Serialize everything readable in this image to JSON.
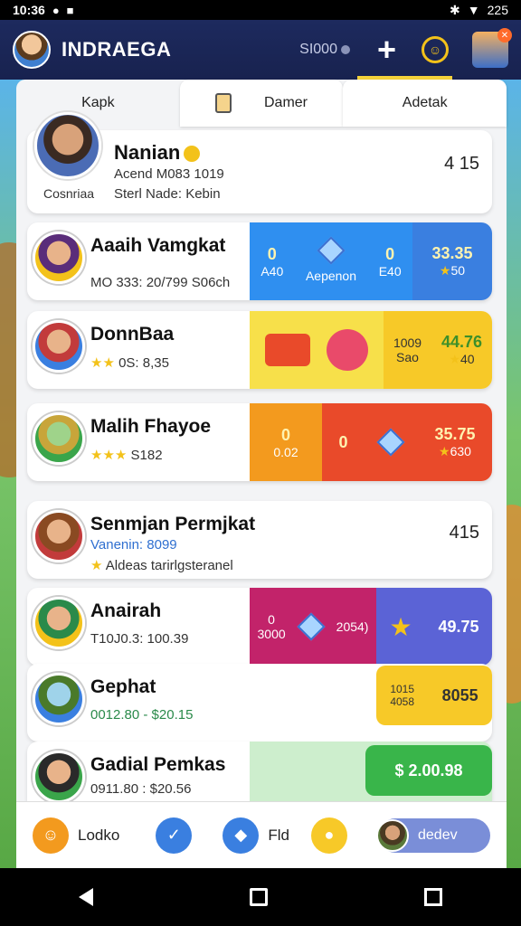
{
  "status": {
    "time": "10:36",
    "battery": "225"
  },
  "header": {
    "title": "INDRAEGA",
    "coins": "SI000"
  },
  "tabs": [
    {
      "label": "Kapk"
    },
    {
      "label": "Damer"
    },
    {
      "label": "Adetak"
    }
  ],
  "profile": {
    "name": "Nanian",
    "line2": "Acend M083 1019",
    "line3": "Sterl Nade: Kebin",
    "caption": "Cosnriaa",
    "value": "4 15"
  },
  "rows": [
    {
      "name": "Aaaih Vamgkat",
      "sub": "MO 333: 20/799 S06ch",
      "segs": [
        "0",
        "A40",
        "Aepenon",
        "0",
        "E40",
        "33.35",
        "50"
      ],
      "value": ""
    },
    {
      "name": "DonnBaa",
      "sub": "0S: 8,35",
      "segs": [
        "1009",
        "Sao",
        "44.76",
        "40"
      ],
      "value": ""
    },
    {
      "name": "Malih Fhayoe",
      "sub": "S182",
      "segs": [
        "0",
        "0.02",
        "0",
        "35.75",
        "630"
      ],
      "value": ""
    },
    {
      "name": "Senmjan Permjkat",
      "sub": "Vanenin: 8099",
      "sub2": "Aldeas tarirlgsteranel",
      "value": "415"
    },
    {
      "name": "Anairah",
      "sub": "T10J0.3: 100.39",
      "segs": [
        "0",
        "3000",
        "2054)",
        "49.75"
      ],
      "value": ""
    },
    {
      "name": "Gephat",
      "sub": "0012.80 - $20.15",
      "segs": [
        "1015",
        "4058",
        "8055"
      ],
      "value": ""
    },
    {
      "name": "Gadial Pemkas",
      "sub": "0911.80 : $20.56",
      "segs": [
        "2.00.98"
      ],
      "value": ""
    }
  ],
  "bottom": {
    "label1": "Lodko",
    "label2": "Fld",
    "pill": "dedev"
  },
  "colors": {
    "blue": "#2f8ff0",
    "yellow": "#f7c928",
    "orange": "#f39a1e",
    "red": "#e94a2a",
    "magenta": "#c2236a",
    "indigo": "#5b63d6",
    "green": "#39b54a"
  }
}
